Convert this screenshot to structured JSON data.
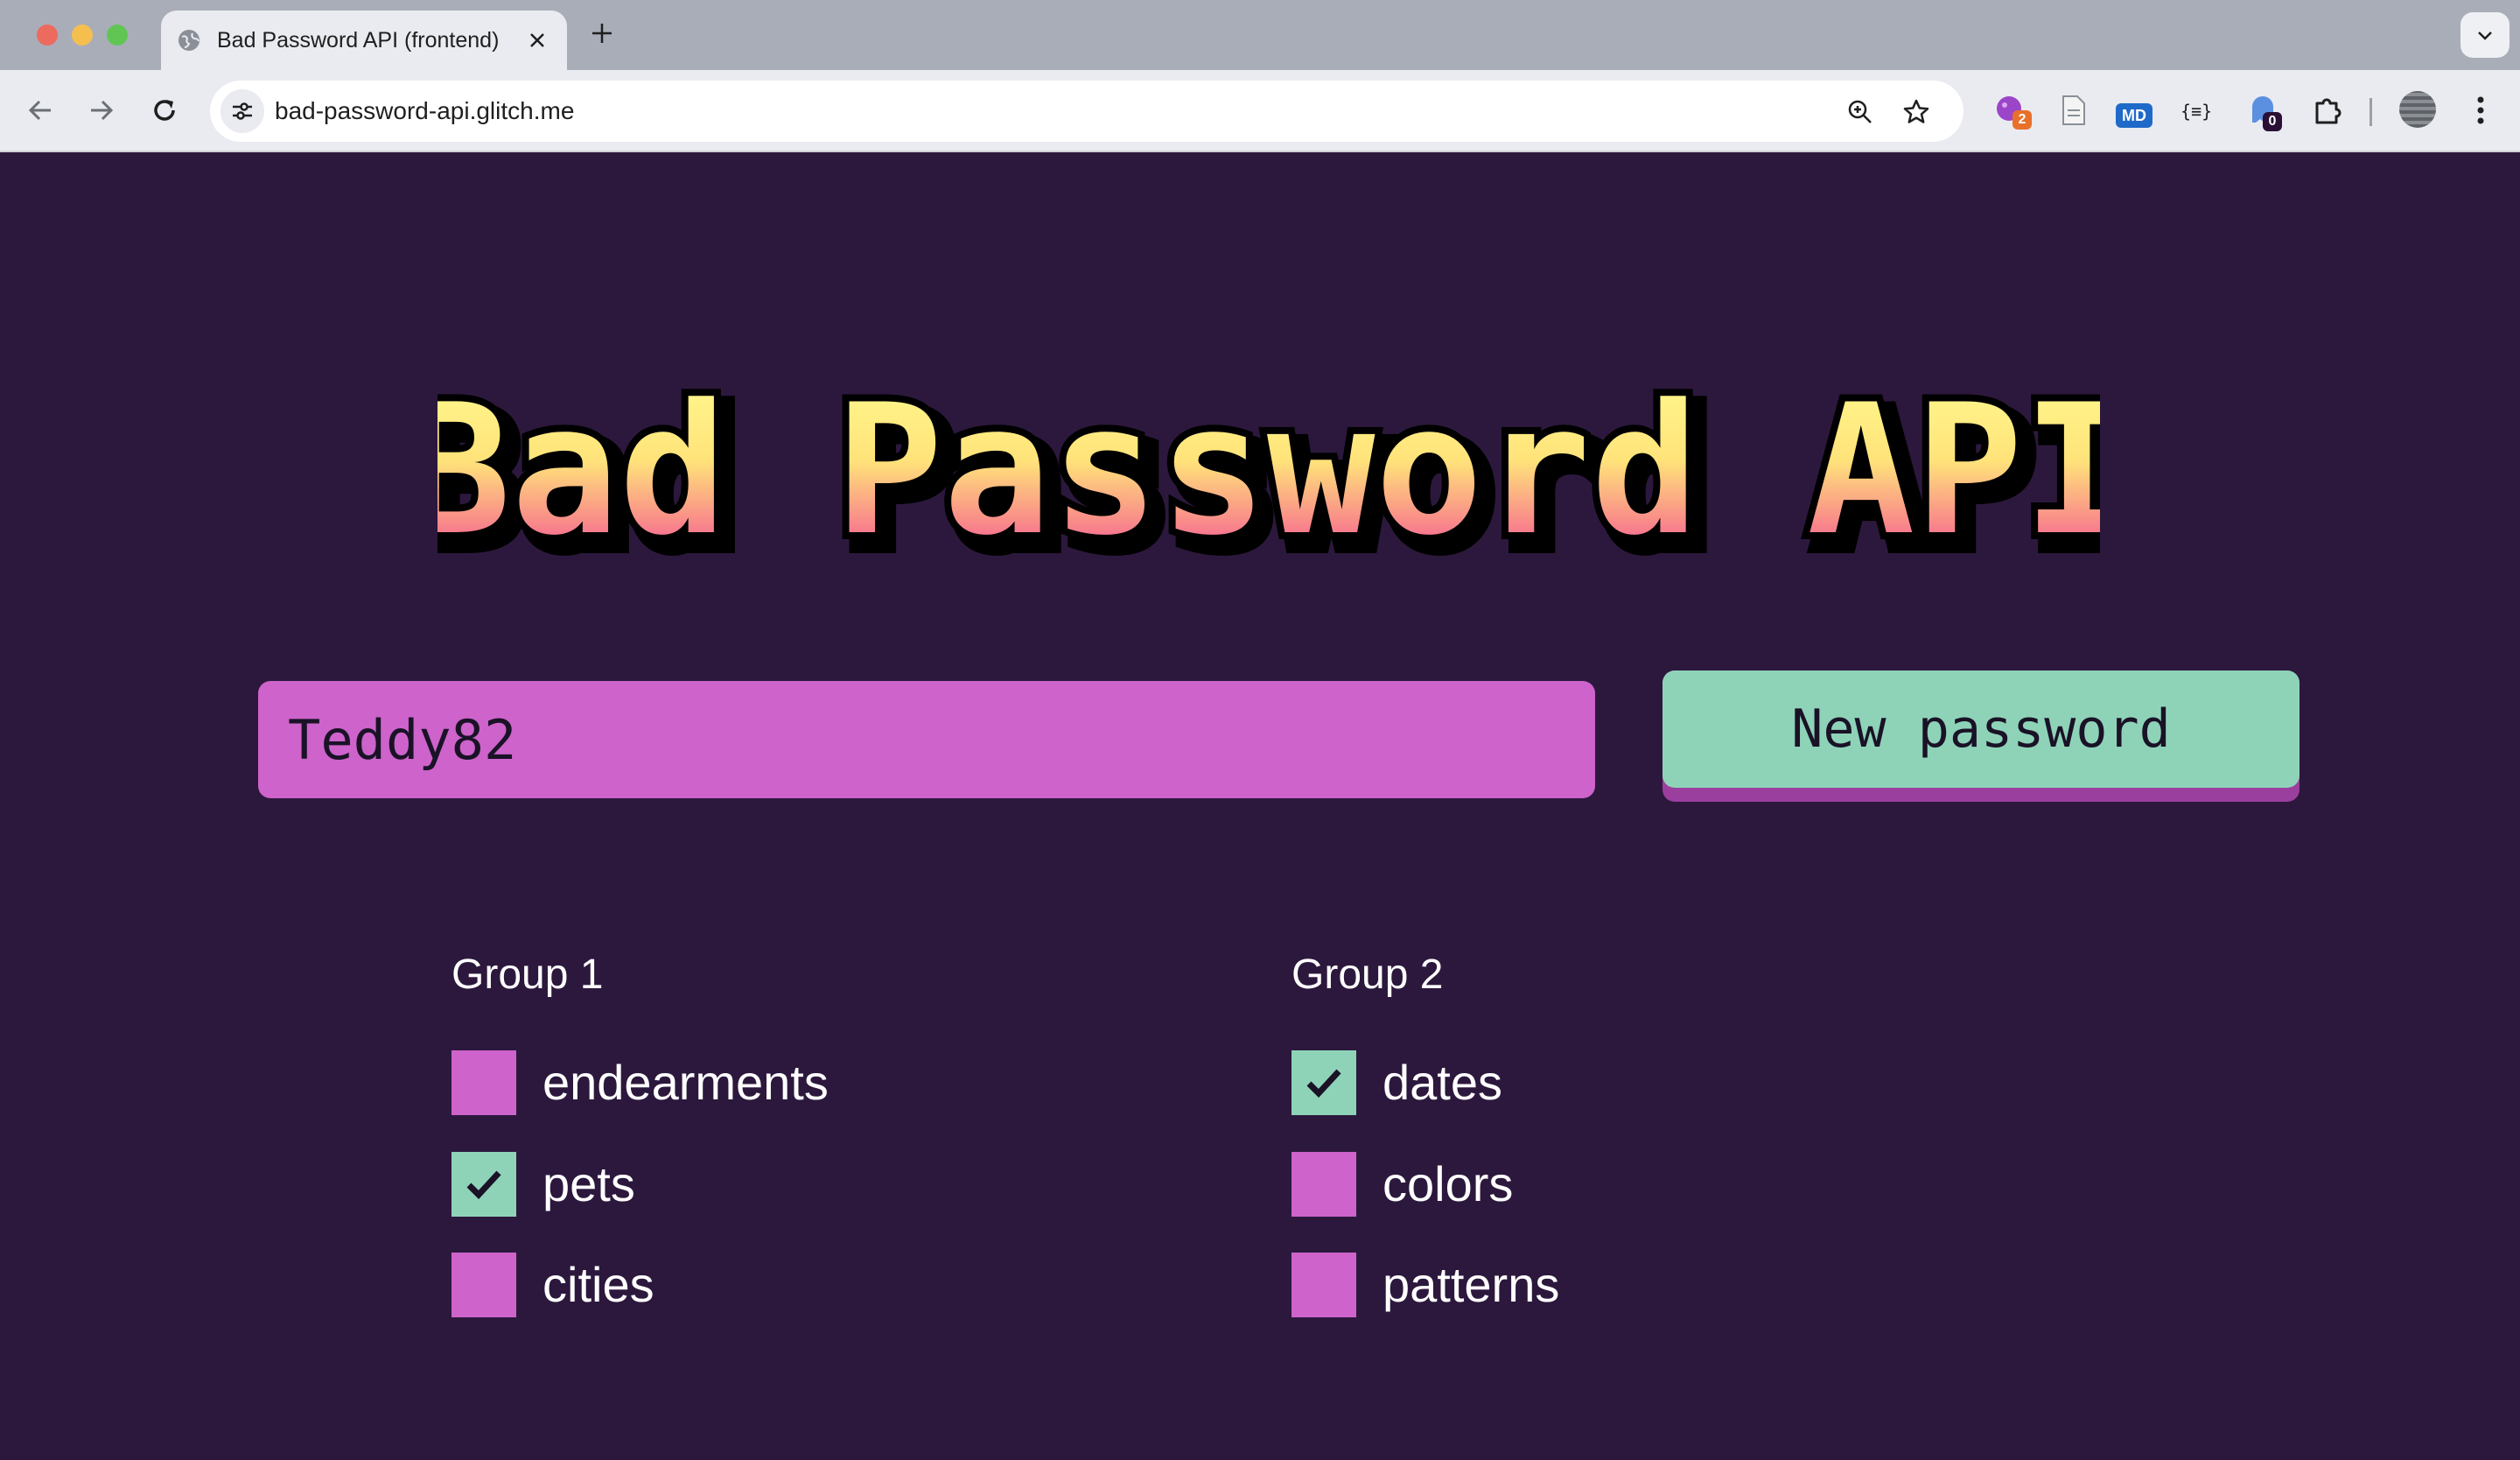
{
  "browser": {
    "tab_title": "Bad Password API (frontend)",
    "url": "bad-password-api.glitch.me",
    "extensions": [
      {
        "icon": "purple-extension-icon",
        "badge": "2"
      },
      {
        "icon": "document-extension-icon",
        "badge": ""
      },
      {
        "icon": "markdown-extension-icon",
        "label": "MD"
      },
      {
        "icon": "json-extension-icon",
        "label": "{≡}"
      },
      {
        "icon": "ghost-extension-icon",
        "badge": "0"
      }
    ]
  },
  "colors": {
    "page_bg": "#2c183d",
    "pink": "#cd63cb",
    "mint": "#8ed3b8",
    "button_shadow": "#9b3f9e",
    "title_gradient_top": "#fffb8f",
    "title_gradient_bottom": "#ee3d9f"
  },
  "header": {
    "title": "Bad Password API"
  },
  "form": {
    "password_value": "Teddy82",
    "new_password_label": "New password"
  },
  "groups": [
    {
      "label": "Group 1",
      "options": [
        {
          "label": "endearments",
          "checked": false
        },
        {
          "label": "pets",
          "checked": true
        },
        {
          "label": "cities",
          "checked": false
        }
      ]
    },
    {
      "label": "Group 2",
      "options": [
        {
          "label": "dates",
          "checked": true
        },
        {
          "label": "colors",
          "checked": false
        },
        {
          "label": "patterns",
          "checked": false
        }
      ]
    }
  ]
}
